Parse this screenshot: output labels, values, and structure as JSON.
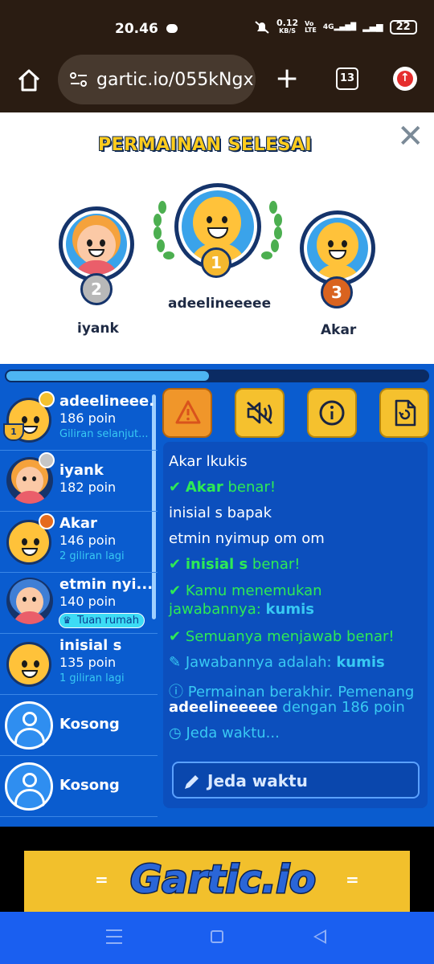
{
  "status": {
    "time": "20.46",
    "speed": "0.12",
    "speed_unit": "KB/S",
    "network": "4G",
    "battery": "22"
  },
  "browser": {
    "url": "gartic.io/055kNgx",
    "tab_count": "13"
  },
  "podium": {
    "title": "PERMAINAN SELESAI",
    "first": {
      "name": "adeelineeeee",
      "rank": "1"
    },
    "second": {
      "name": "iyank",
      "rank": "2"
    },
    "third": {
      "name": "Akar",
      "rank": "3"
    }
  },
  "progress": 0.48,
  "players": [
    {
      "name": "adeelineee...",
      "points": "186 poin",
      "sub": "Giliran selanjut...",
      "dot": "#f5c12e"
    },
    {
      "name": "iyank",
      "points": "182 poin",
      "sub": "",
      "dot": "#c6c6c6"
    },
    {
      "name": "Akar",
      "points": "146 poin",
      "sub": "2 giliran lagi",
      "dot": "#e56b1d"
    },
    {
      "name": "etmin nyi...",
      "points": "140 poin",
      "host": "Tuan rumah"
    },
    {
      "name": "inisial s",
      "points": "135 poin",
      "sub": "1 giliran lagi"
    },
    {
      "name": "Kosong"
    },
    {
      "name": "Kosong"
    }
  ],
  "chat": {
    "l1_name": "Akar",
    "l1_text": "lkukis",
    "l2_name": "Akar",
    "l2_text": "benar!",
    "l3_name": "inisial s",
    "l3_text": "bapak",
    "l4_name": "etmin nyimup",
    "l4_text": "om om",
    "l5_name": "inisial s",
    "l5_text": "benar!",
    "l6_a": "Kamu menemukan",
    "l6_b": "jawabannya:",
    "l6_word": "kumis",
    "l7": "Semuanya menjawab benar!",
    "l8_text": "Jawabannya adalah:",
    "l8_word": "kumis",
    "l9_a": "Permainan berakhir. Pemenang",
    "l9_name": "adeelineeeee",
    "l9_b": "dengan 186 poin",
    "l10": "Jeda waktu..."
  },
  "guess_button": "Jeda waktu",
  "ad": {
    "logo": "Gartic.io"
  }
}
